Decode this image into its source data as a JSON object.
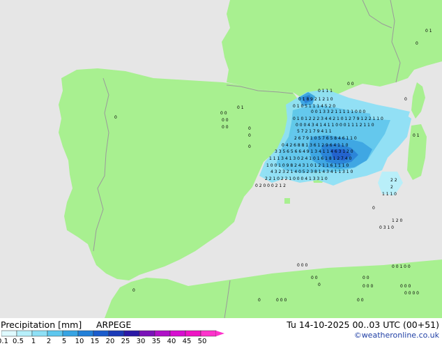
{
  "header": {
    "title": "Precipitation [mm]",
    "model": "ARPEGE",
    "datetime": "Tu 14-10-2025 00..03 UTC (00+51)",
    "credit": "©weatheronline.co.uk"
  },
  "legend": {
    "ticks": [
      "0.1",
      "0.5",
      "1",
      "2",
      "5",
      "10",
      "15",
      "20",
      "25",
      "30",
      "35",
      "40",
      "45",
      "50"
    ],
    "colors": [
      "#dffaff",
      "#b7f0fb",
      "#8ee0f6",
      "#5ec7ee",
      "#37a4e3",
      "#2280d8",
      "#1a5ccc",
      "#1a3ab8",
      "#2a18a6",
      "#7a12b8",
      "#b010c8",
      "#d70ed0",
      "#ef14c4",
      "#ff33cc"
    ]
  },
  "map": {
    "land_color": "#a8f090",
    "sea_color": "#e6e6e6",
    "border_color": "#9a9a9a"
  }
}
